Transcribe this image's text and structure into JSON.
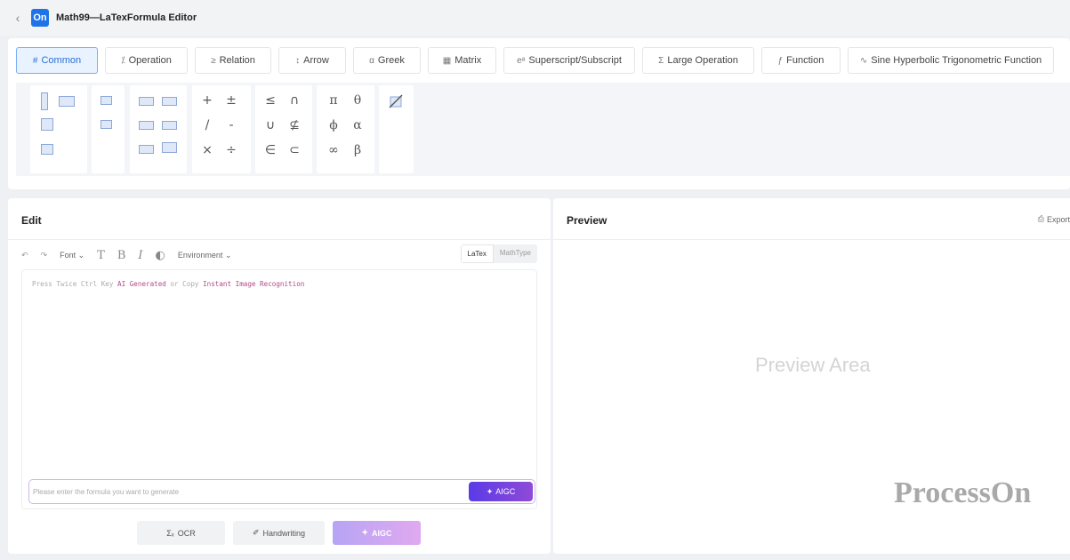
{
  "window": {
    "title": "Math99—LaTexFormula Editor",
    "logo_text": "On",
    "back_icon": "‹"
  },
  "tabs": [
    {
      "icon": "#",
      "label": "Common",
      "active": true
    },
    {
      "icon": "⁒",
      "label": "Operation"
    },
    {
      "icon": "≥",
      "label": "Relation"
    },
    {
      "icon": "↕",
      "label": "Arrow"
    },
    {
      "icon": "α",
      "label": "Greek"
    },
    {
      "icon": "▦",
      "label": "Matrix"
    },
    {
      "icon": "eᵃ",
      "label": "Superscript/Subscript"
    },
    {
      "icon": "Σ",
      "label": "Large Operation"
    },
    {
      "icon": "ƒ",
      "label": "Function"
    },
    {
      "icon": "∿",
      "label": "Sine Hyperbolic Trigonometric Function"
    }
  ],
  "symbols": {
    "g4": [
      "+",
      "±",
      "/",
      "-",
      "×",
      "÷"
    ],
    "g5": [
      "≤",
      "∩",
      "∪",
      "⊈",
      "∈",
      "⊂"
    ],
    "g6": [
      "π",
      "θ",
      "ϕ",
      "α",
      "∞",
      "β"
    ]
  },
  "edit": {
    "title": "Edit",
    "toolbar": {
      "undo": "↶",
      "redo": "↷",
      "font": "Font",
      "t_icon": "T",
      "b_icon": "B",
      "i_icon": "I",
      "palette_icon": "◐",
      "environment": "Environment",
      "dropdown": "⌄",
      "mode_latex": "LaTex",
      "mode_mathtype": "MathType"
    },
    "hint": {
      "p1": "Press Twice Ctrl Key ",
      "p2": "AI Generated",
      "p3": " or Copy ",
      "p4": "Instant Image Recognition"
    },
    "gen_placeholder": "Please enter the formula you want to generate",
    "aigc_small": "AIGC",
    "ocr": "OCR",
    "handwriting": "Handwriting",
    "aigc": "AIGC",
    "ocr_icon": "Σₓ",
    "hand_icon": "✐",
    "spark_icon": "✦"
  },
  "preview": {
    "title": "Preview",
    "export": "Export",
    "export_icon": "⎙",
    "area_text": "Preview Area"
  },
  "watermark": "ProcessOn",
  "colors": {
    "accent": "#2b6fd6",
    "aigc": "#6a3fe0"
  }
}
